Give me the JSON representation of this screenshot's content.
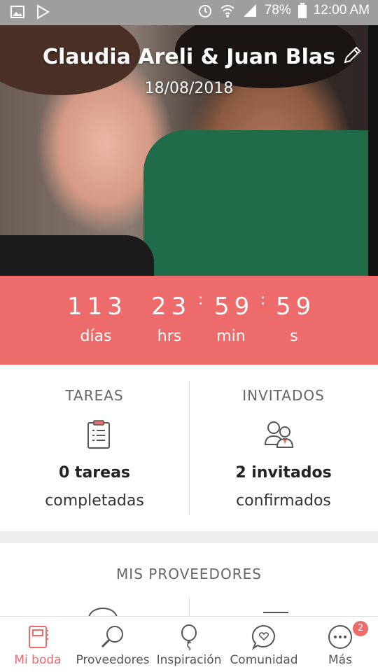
{
  "status_bar": {
    "battery": "78%",
    "time": "12:00 AM"
  },
  "hero": {
    "couple_names": "Claudia Areli & Juan Blas",
    "wedding_date": "18/08/2018"
  },
  "countdown": {
    "days": "113",
    "hours": "23",
    "minutes": "59",
    "seconds": "59",
    "days_label": "días",
    "hours_label": "hrs",
    "minutes_label": "min",
    "seconds_label": "s"
  },
  "tasks": {
    "title": "TAREAS",
    "value": "0 tareas",
    "sub": "completadas"
  },
  "guests": {
    "title": "INVITADOS",
    "value": "2 invitados",
    "sub": "confirmados"
  },
  "providers": {
    "title": "MIS PROVEEDORES"
  },
  "nav": {
    "items": [
      {
        "label": "Mi boda",
        "icon": "notebook-icon",
        "active": true
      },
      {
        "label": "Proveedores",
        "icon": "search-icon",
        "active": false
      },
      {
        "label": "Inspiración",
        "icon": "balloon-icon",
        "active": false
      },
      {
        "label": "Comunidad",
        "icon": "chat-heart-icon",
        "active": false
      },
      {
        "label": "Más",
        "icon": "more-icon",
        "active": false,
        "badge": "2"
      }
    ]
  },
  "colors": {
    "accent": "#ee6b6b",
    "statusbar": "#9e9e9e"
  }
}
